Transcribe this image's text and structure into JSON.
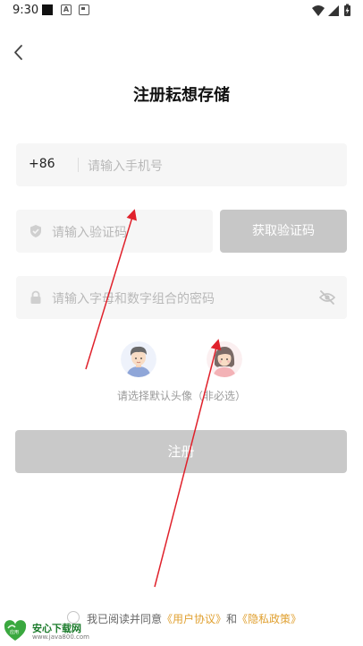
{
  "status_bar": {
    "time": "9:30",
    "icons": [
      "black-square-icon",
      "a-box-icon",
      "card-icon",
      "wifi-icon",
      "signal-icon",
      "battery-icon"
    ]
  },
  "header": {
    "title": "注册耘想存储",
    "back_icon": "chevron-left-icon"
  },
  "form": {
    "phone": {
      "prefix": "+86",
      "placeholder": "请输入手机号"
    },
    "code": {
      "placeholder": "请输入验证码",
      "icon": "shield-icon",
      "button_label": "获取验证码"
    },
    "password": {
      "placeholder": "请输入字母和数字组合的密码",
      "icon": "lock-icon",
      "toggle_icon": "eye-off-icon"
    }
  },
  "avatars": {
    "hint": "请选择默认头像（非必选）",
    "options": [
      "boy-avatar",
      "girl-avatar"
    ]
  },
  "register_label": "注册",
  "agreement": {
    "prefix": "我已阅读并同意",
    "user_agreement": "《用户协议》",
    "and": "和",
    "privacy_policy": "《隐私政策》"
  },
  "watermark": {
    "title": "安心下载网",
    "url": "www.java800.com",
    "logo_text": "应用"
  },
  "colors": {
    "link": "#e0a030",
    "disabled_button": "#c9c9c9",
    "field_bg": "#f6f6f6",
    "annotation_arrow": "#e0212b"
  }
}
